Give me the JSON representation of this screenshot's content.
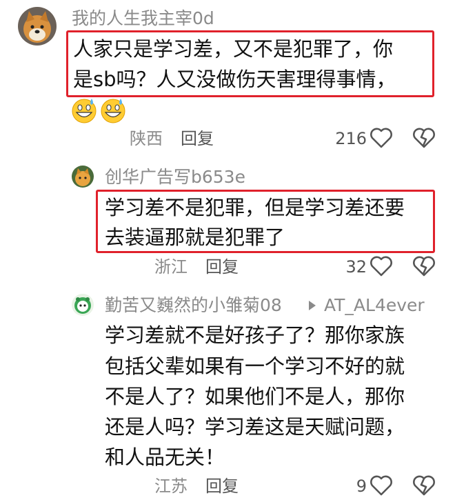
{
  "comments": [
    {
      "username": "我的人生我主宰0d",
      "lines": [
        "人家只是学习差，又不是犯罪了，你",
        "是sb吗？人又没做伤天害理得事情，"
      ],
      "emoji": [
        "sweat-grin-emoji",
        "sweat-grin-emoji"
      ],
      "location": "陕西",
      "reply_label": "回复",
      "likes": "216"
    },
    {
      "username": "创华广告写b653e",
      "lines": [
        "学习差不是犯罪，但是学习差还要",
        "去装逼那就是犯罪了"
      ],
      "location": "浙江",
      "reply_label": "回复",
      "likes": "32"
    },
    {
      "username": "勤苦又巍然的小雏菊08",
      "reply_to": "AT_AL4ever",
      "lines": [
        "学习差就不是好孩子了？那你家族",
        "包括父辈如果有一个学习不好的就",
        "不是人了？如果他们不是人，那你",
        "还是人吗？学习差这是天赋问题，",
        "和人品无关！"
      ],
      "location": "江苏",
      "reply_label": "回复",
      "likes": "9"
    }
  ],
  "colors": {
    "highlight": "#e0212b",
    "muted": "#8a8a8a"
  }
}
